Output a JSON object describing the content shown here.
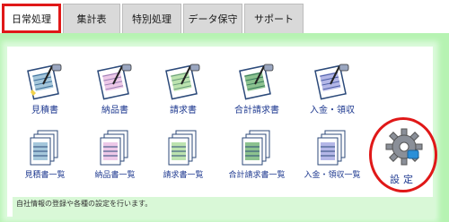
{
  "tabs": [
    {
      "label": "日常処理",
      "active": true
    },
    {
      "label": "集計表"
    },
    {
      "label": "特別処理"
    },
    {
      "label": "データ保守"
    },
    {
      "label": "サポート"
    }
  ],
  "menu_row1": [
    {
      "label": "見積書",
      "icon": "quote-document-icon"
    },
    {
      "label": "納品書",
      "icon": "delivery-slip-icon"
    },
    {
      "label": "請求書",
      "icon": "invoice-document-icon"
    },
    {
      "label": "合計請求書",
      "icon": "summary-invoice-icon"
    },
    {
      "label": "入金・領収",
      "icon": "payment-receipt-icon"
    }
  ],
  "menu_row2": [
    {
      "label": "見積書一覧",
      "icon": "quote-list-icon"
    },
    {
      "label": "納品書一覧",
      "icon": "delivery-list-icon"
    },
    {
      "label": "請求書一覧",
      "icon": "invoice-list-icon"
    },
    {
      "label": "合計請求書一覧",
      "icon": "summary-invoice-list-icon"
    },
    {
      "label": "入金・領収一覧",
      "icon": "payment-list-icon"
    }
  ],
  "settings": {
    "label": "設定",
    "icon": "gear-icon"
  },
  "status_text": "自社情報の登録や各種の設定を行います。",
  "colors": {
    "active_highlight": "#e01818",
    "panel_bg": "#b6f3b2",
    "label_text": "#1f3a90"
  }
}
